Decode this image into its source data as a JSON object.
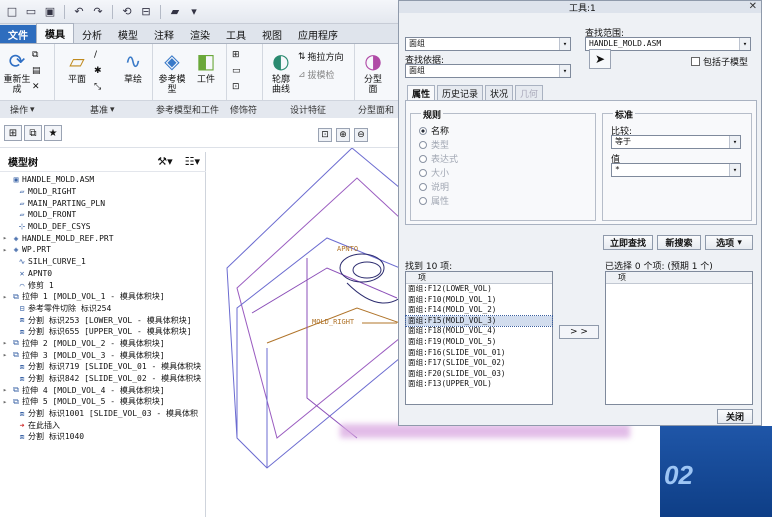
{
  "quick_toolbar": {
    "icons": [
      "new-icon",
      "open-icon",
      "save-icon",
      "undo-icon",
      "redo-icon",
      "regenerate-icon",
      "windows-icon",
      "folder-icon"
    ]
  },
  "ribbon": {
    "tabs": [
      "文件",
      "模具",
      "分析",
      "模型",
      "注释",
      "渲染",
      "工具",
      "视图",
      "应用程序"
    ],
    "buttons": {
      "refresh": "重新生\n成",
      "plane": "平面",
      "sketch": "草绘",
      "ref_model": "参考模\n型",
      "workpiece": "工件",
      "profile_curve": "轮廓\n曲线",
      "draft_direction": "拖拉方向",
      "draft_check": "拔模检",
      "split": "分型\n面"
    },
    "groups": [
      "操作",
      "基准",
      "参考模型和工件",
      "修饰符",
      "设计特征",
      "分型面和"
    ]
  },
  "model_tree": {
    "title": "模型树",
    "items": [
      {
        "label": "HANDLE_MOLD.ASM",
        "icon": "assembly-icon",
        "expand": "",
        "indent": 0
      },
      {
        "label": "MOLD_RIGHT",
        "icon": "datum-plane-icon",
        "expand": "",
        "indent": 1
      },
      {
        "label": "MAIN_PARTING_PLN",
        "icon": "datum-plane-icon",
        "expand": "",
        "indent": 1
      },
      {
        "label": "MOLD_FRONT",
        "icon": "datum-plane-icon",
        "expand": "",
        "indent": 1
      },
      {
        "label": "MOLD_DEF_CSYS",
        "icon": "csys-icon",
        "expand": "",
        "indent": 1
      },
      {
        "label": "HANDLE_MOLD_REF.PRT",
        "icon": "part-icon",
        "expand": "▸",
        "indent": 0
      },
      {
        "label": "WP.PRT",
        "icon": "part-icon",
        "expand": "▸",
        "indent": 0
      },
      {
        "label": "SILH_CURVE_1",
        "icon": "curve-icon",
        "expand": "",
        "indent": 1
      },
      {
        "label": "APNT0",
        "icon": "point-icon",
        "expand": "",
        "indent": 1
      },
      {
        "label": "修剪 1",
        "icon": "trim-icon",
        "expand": "",
        "indent": 1
      },
      {
        "label": "拉伸 1 [MOLD_VOL_1 - 模具体积块]",
        "icon": "extrude-icon",
        "expand": "▸",
        "indent": 0
      },
      {
        "label": "参考零件切除 标识254",
        "icon": "cut-icon",
        "expand": "",
        "indent": 1
      },
      {
        "label": "分割 标识253 [LOWER_VOL - 模具体积块]",
        "icon": "split-icon",
        "expand": "",
        "indent": 1
      },
      {
        "label": "分割 标识655 [UPPER_VOL - 模具体积块]",
        "icon": "split-icon",
        "expand": "",
        "indent": 1
      },
      {
        "label": "拉伸 2 [MOLD_VOL_2 - 模具体积块]",
        "icon": "extrude-icon",
        "expand": "▸",
        "indent": 0
      },
      {
        "label": "拉伸 3 [MOLD_VOL_3 - 模具体积块]",
        "icon": "extrude-icon",
        "expand": "▸",
        "indent": 0
      },
      {
        "label": "分割 标识719 [SLIDE_VOL_01 - 模具体积块",
        "icon": "split-icon",
        "expand": "",
        "indent": 1
      },
      {
        "label": "分割 标识842 [SLIDE_VOL_02 - 模具体积块",
        "icon": "split-icon",
        "expand": "",
        "indent": 1
      },
      {
        "label": "拉伸 4 [MOLD_VOL_4 - 模具体积块]",
        "icon": "extrude-icon",
        "expand": "▸",
        "indent": 0
      },
      {
        "label": "拉伸 5 [MOLD_VOL_5 - 模具体积块]",
        "icon": "extrude-icon",
        "expand": "▸",
        "indent": 0
      },
      {
        "label": "分割 标识1001 [SLIDE_VOL_03 - 模具体积",
        "icon": "split-icon",
        "expand": "",
        "indent": 1
      },
      {
        "label": "在此插入",
        "icon": "insert-arrow-icon",
        "expand": "",
        "indent": 1
      },
      {
        "label": "分割 标识1040",
        "icon": "split-icon",
        "expand": "",
        "indent": 1
      }
    ]
  },
  "graphics": {
    "labels": [
      "APNTO",
      "MOLD_RIGHT"
    ]
  },
  "search_dialog": {
    "title": "工具:1",
    "lookfor_value": "面组",
    "lookin_label": "查找范围:",
    "lookin_value": "HANDLE_MOLD.ASM",
    "by_label": "查找依据:",
    "by_value": "面组",
    "include_sub": "包括子模型",
    "tabs": [
      "属性",
      "历史记录",
      "状况",
      "几何"
    ],
    "rules_title": "规则",
    "rules": [
      "名称",
      "类型",
      "表达式",
      "大小",
      "说明",
      "属性"
    ],
    "criteria_title": "标准",
    "compare_label": "比较:",
    "compare_value": "等于",
    "value_label": "值",
    "value_value": "*",
    "btn_find_now": "立即查找",
    "btn_new_search": "新搜索",
    "btn_options": "选项",
    "found_label": "找到 10 项:",
    "found_header": "项",
    "found_items": [
      "面组:F12(LOWER_VOL)",
      "面组:F10(MOLD_VOL_1)",
      "面组:F14(MOLD_VOL_2)",
      "面组:F15(MOLD_VOL_3)",
      "面组:F18(MOLD_VOL_4)",
      "面组:F19(MOLD_VOL_5)",
      "面组:F16(SLIDE_VOL_01)",
      "面组:F17(SLIDE_VOL_02)",
      "面组:F20(SLIDE_VOL_03)",
      "面组:F13(UPPER_VOL)"
    ],
    "selected_label": "已选择 0 个项: (预期 1 个)",
    "selected_header": "项",
    "move_button": "> >",
    "close_button": "关闭"
  },
  "background_window": {
    "text": "02"
  }
}
